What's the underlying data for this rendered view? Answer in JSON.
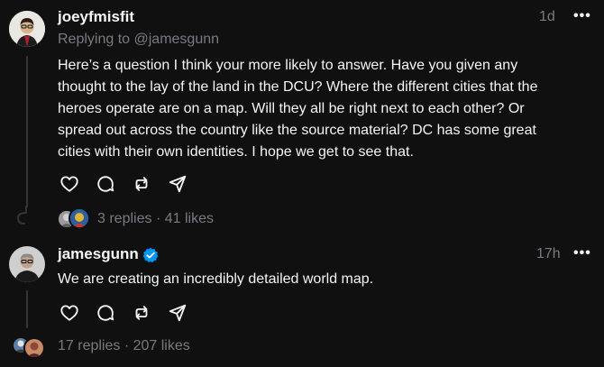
{
  "post": {
    "author": "joeyfmisfit",
    "timestamp": "1d",
    "more_label": "•••",
    "replying_prefix": "Replying to ",
    "replying_to": "@jamesgunn",
    "lines": [
      "Here’s a question I think your more likely to answer. Have you given any",
      "thought to the lay of the land in the DCU? Where the different cities that the",
      "heroes operate are on a map. Will they all be right next to each other? Or",
      "spread out across the country like the source material? DC has some great",
      "cities with their own identities. I hope we get to see that."
    ],
    "replies": "3 replies",
    "separator": "·",
    "likes": "41 likes"
  },
  "reply": {
    "author": "jamesgunn",
    "verified_icon": "verified-badge-icon",
    "timestamp": "17h",
    "more_label": "•••",
    "text": "We are creating an incredibly detailed world map.",
    "replies": "17 replies",
    "separator": "·",
    "likes": "207 likes"
  },
  "icons": {
    "like": "heart-icon",
    "comment": "comment-icon",
    "repost": "repost-icon",
    "share": "send-icon"
  },
  "colors": {
    "background": "#101010",
    "text": "#f3f5f7",
    "muted": "#777b80",
    "verified": "#0095f6"
  }
}
